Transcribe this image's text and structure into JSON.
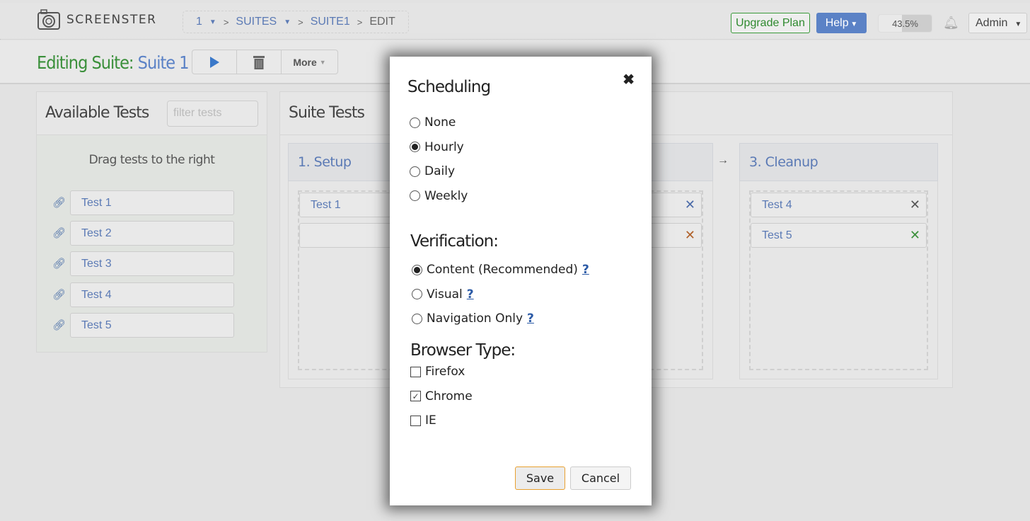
{
  "header": {
    "brand": "SCREENSTER",
    "breadcrumb": [
      "1",
      "SUITES",
      "SUITE1",
      "EDIT"
    ],
    "upgrade_label": "Upgrade Plan",
    "help_label": "Help",
    "usage_percent": 43.5,
    "usage_label": "43.5%",
    "user_label": "Admin"
  },
  "toolbar": {
    "title_prefix": "Editing Suite:",
    "suite_name": "Suite 1",
    "more_label": "More"
  },
  "available": {
    "title": "Available Tests",
    "filter_placeholder": "filter tests",
    "hint": "Drag tests to the right",
    "tests": [
      "Test 1",
      "Test 2",
      "Test 3",
      "Test 4",
      "Test 5"
    ]
  },
  "suite": {
    "title": "Suite Tests",
    "stages": [
      {
        "title": "1. Setup",
        "tests": [
          "Test 1",
          ""
        ]
      },
      {
        "title": "3. Cleanup",
        "tests": [
          "Test 4",
          "Test 5"
        ]
      }
    ]
  },
  "modal": {
    "scheduling_title": "Scheduling",
    "scheduling": [
      {
        "label": "None",
        "checked": false
      },
      {
        "label": "Hourly",
        "checked": true
      },
      {
        "label": "Daily",
        "checked": false
      },
      {
        "label": "Weekly",
        "checked": false
      }
    ],
    "verification_title": "Verification:",
    "verification": [
      {
        "label": "Content (Recommended)",
        "checked": true
      },
      {
        "label": "Visual",
        "checked": false
      },
      {
        "label": "Navigation Only",
        "checked": false
      }
    ],
    "help_mark": "?",
    "browser_title": "Browser Type:",
    "browsers": [
      {
        "label": "Firefox",
        "checked": false
      },
      {
        "label": "Chrome",
        "checked": true
      },
      {
        "label": "IE",
        "checked": false
      }
    ],
    "save_label": "Save",
    "cancel_label": "Cancel"
  },
  "colors": {
    "accent_blue": "#5b82c6",
    "green": "#3a8f3a"
  }
}
